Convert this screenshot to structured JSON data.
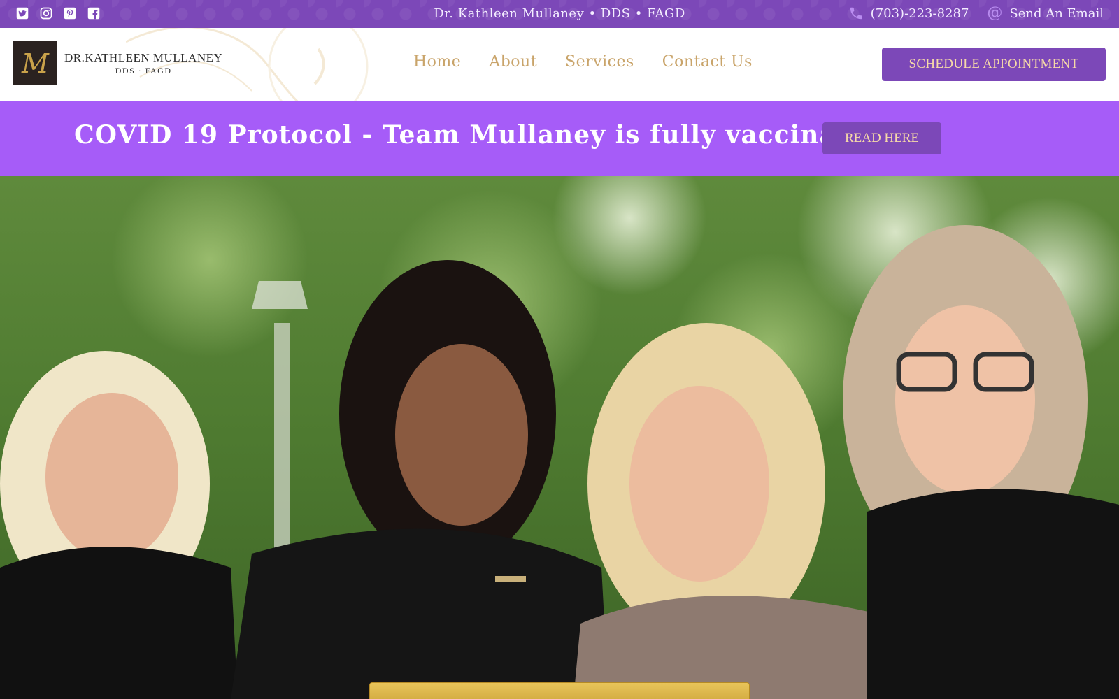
{
  "topbar": {
    "social_icons": [
      "twitter-icon",
      "instagram-icon",
      "pinterest-icon",
      "facebook-icon"
    ],
    "center_text": "Dr. Kathleen Mullaney • DDS • FAGD",
    "phone": "(703)-223-8287",
    "email_label": "Send An Email",
    "background_color": "#7c48b8"
  },
  "header": {
    "logo": {
      "monogram": "M",
      "name": "DR.KATHLEEN MULLANEY",
      "subtitle": "DDS · FAGD"
    },
    "nav": [
      "Home",
      "About",
      "Services",
      "Contact Us"
    ],
    "nav_color": "#c9a46a",
    "cta_label": "SCHEDULE APPOINTMENT"
  },
  "banner": {
    "text": "COVID 19 Protocol - Team Mullaney is fully vaccinated",
    "button_label": "READ HERE",
    "background_color": "#a65cf8"
  },
  "hero": {
    "image": "team-photo"
  }
}
